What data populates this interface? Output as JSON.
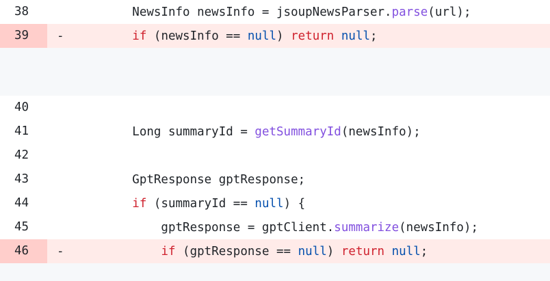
{
  "lines": [
    {
      "num": "38",
      "marker": "",
      "segments": [
        {
          "t": "        NewsInfo newsInfo = jsoupNewsParser.",
          "c": ""
        },
        {
          "t": "parse",
          "c": "fn"
        },
        {
          "t": "(url);",
          "c": ""
        }
      ]
    },
    {
      "num": "39",
      "marker": "-",
      "segments": [
        {
          "t": "        ",
          "c": ""
        },
        {
          "t": "if",
          "c": "kw"
        },
        {
          "t": " (newsInfo == ",
          "c": ""
        },
        {
          "t": "null",
          "c": "lit"
        },
        {
          "t": ") ",
          "c": ""
        },
        {
          "t": "return",
          "c": "kw"
        },
        {
          "t": " ",
          "c": ""
        },
        {
          "t": "null",
          "c": "lit"
        },
        {
          "t": ";",
          "c": ""
        }
      ]
    },
    {
      "num": "40",
      "marker": "",
      "segments": []
    },
    {
      "num": "41",
      "marker": "",
      "segments": [
        {
          "t": "        Long summaryId = ",
          "c": ""
        },
        {
          "t": "getSummaryId",
          "c": "fn"
        },
        {
          "t": "(newsInfo);",
          "c": ""
        }
      ]
    },
    {
      "num": "42",
      "marker": "",
      "segments": []
    },
    {
      "num": "43",
      "marker": "",
      "segments": [
        {
          "t": "        GptResponse gptResponse;",
          "c": ""
        }
      ]
    },
    {
      "num": "44",
      "marker": "",
      "segments": [
        {
          "t": "        ",
          "c": ""
        },
        {
          "t": "if",
          "c": "kw"
        },
        {
          "t": " (summaryId == ",
          "c": ""
        },
        {
          "t": "null",
          "c": "lit"
        },
        {
          "t": ") {",
          "c": ""
        }
      ]
    },
    {
      "num": "45",
      "marker": "",
      "segments": [
        {
          "t": "            gptResponse = gptClient.",
          "c": ""
        },
        {
          "t": "summarize",
          "c": "fn"
        },
        {
          "t": "(newsInfo);",
          "c": ""
        }
      ]
    },
    {
      "num": "46",
      "marker": "-",
      "segments": [
        {
          "t": "            ",
          "c": ""
        },
        {
          "t": "if",
          "c": "kw"
        },
        {
          "t": " (gptResponse == ",
          "c": ""
        },
        {
          "t": "null",
          "c": "lit"
        },
        {
          "t": ") ",
          "c": ""
        },
        {
          "t": "return",
          "c": "kw"
        },
        {
          "t": " ",
          "c": ""
        },
        {
          "t": "null",
          "c": "lit"
        },
        {
          "t": ";",
          "c": ""
        }
      ]
    }
  ],
  "colors": {
    "deleted_line_bg": "#ffebe9",
    "deleted_num_bg": "#ffcecb",
    "hunk_gap_bg": "#f6f8fa",
    "keyword": "#cf222e",
    "literal": "#0550ae",
    "function": "#8250df"
  }
}
